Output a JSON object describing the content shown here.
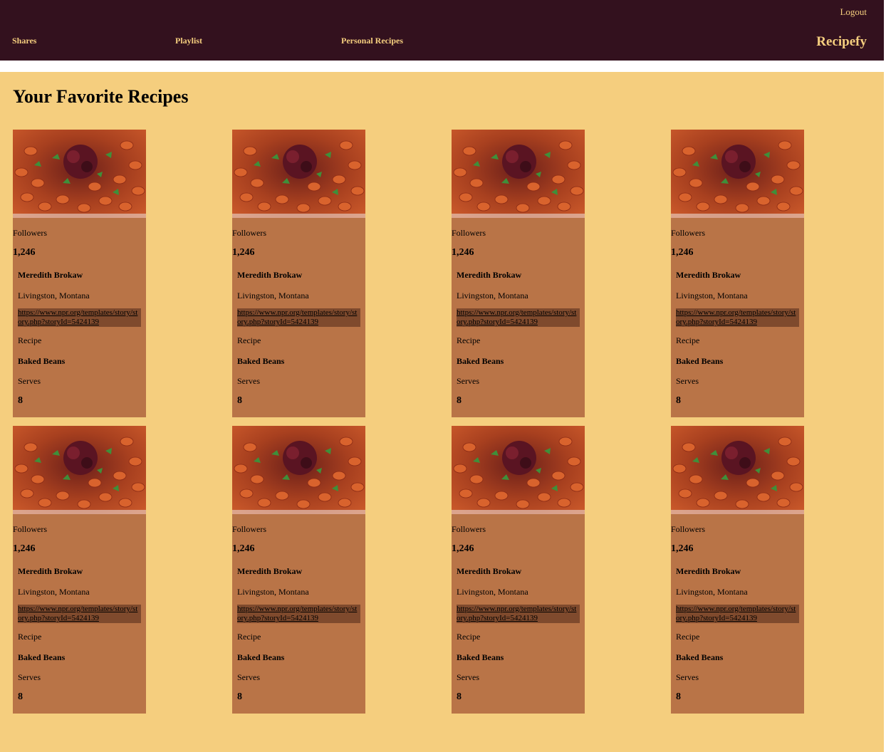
{
  "header": {
    "logout_label": "Logout",
    "nav": [
      "Shares",
      "Playlist",
      "Personal Recipes"
    ],
    "brand": "Recipefy"
  },
  "main": {
    "title": "Your Favorite Recipes"
  },
  "card": {
    "followers_label": "Followers",
    "followers_count": "1,246",
    "name": "Meredith Brokaw",
    "location": "Livingston, Montana",
    "link": "https://www.npr.org/templates/story/story.php?storyId=5424139",
    "recipe_label": "Recipe",
    "recipe_name": "Baked Beans",
    "serves_label": "Serves",
    "serves_count": "8",
    "image": "baked-beans-photo"
  },
  "card_count": 8,
  "colors": {
    "header_bg": "#33111e",
    "accent_text": "#f5ce7e",
    "page_bg": "#f5ce7e",
    "card_bg": "#b97447",
    "link_bg": "#7f4a2d"
  }
}
